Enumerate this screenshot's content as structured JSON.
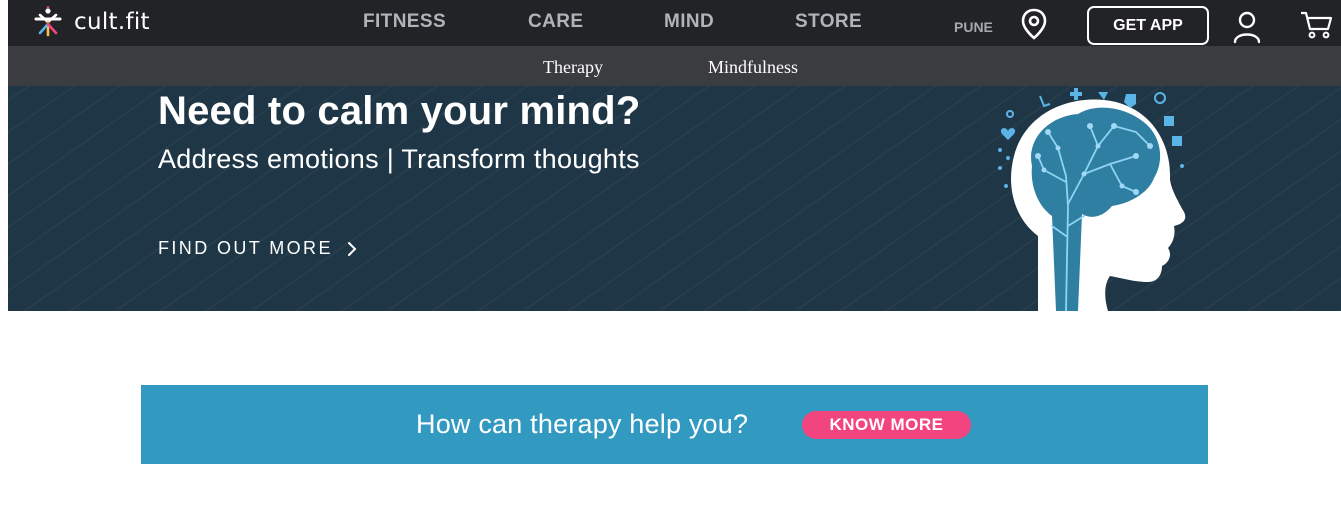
{
  "header": {
    "brand": "cult.fit",
    "nav": [
      "FITNESS",
      "CARE",
      "MIND",
      "STORE"
    ],
    "city": "PUNE",
    "get_app": "GET APP",
    "icons": [
      "cult-logo-icon",
      "location-pin-icon",
      "user-icon",
      "cart-icon"
    ]
  },
  "subnav": {
    "items": [
      "Therapy",
      "Mindfulness"
    ]
  },
  "hero": {
    "title": "Need to calm your mind?",
    "subtitle": "Address emotions | Transform thoughts",
    "cta": "FIND OUT MORE",
    "icons": [
      "chevron-right-icon",
      "brain-head-illustration"
    ]
  },
  "banner": {
    "text": "How can therapy help you?",
    "button": "KNOW MORE"
  },
  "colors": {
    "topbar": "#222327",
    "subnav": "#3b3c3f",
    "hero_bg": "#1f3646",
    "banner_bg": "#3299c0",
    "accent_pink": "#f2447e",
    "illustration_blue": "#5ab4e6"
  }
}
